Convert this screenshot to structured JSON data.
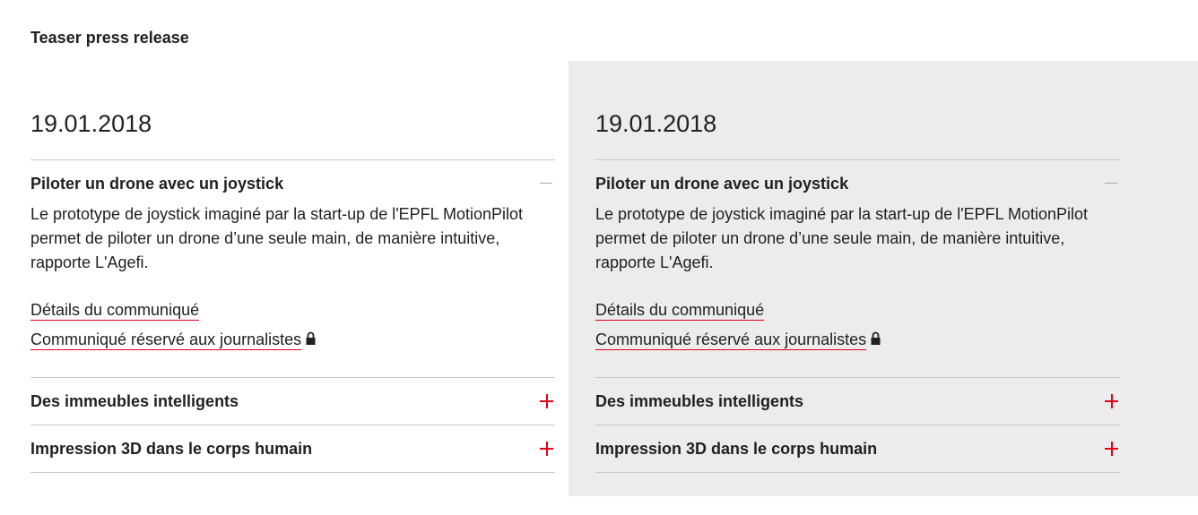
{
  "section": {
    "title": "Teaser press release"
  },
  "columns": [
    {
      "date": "19.01.2018",
      "open_item": {
        "title": "Piloter un drone avec un joystick",
        "description": "Le prototype de joystick imaginé par la start-up de l'EPFL MotionPilot permet de piloter un drone d’une seule main, de manière intuitive, rapporte L'Agefi.",
        "details_link": "Détails du communiqué",
        "journalists_link": "Communiqué réservé aux journalistes"
      },
      "closed_items": [
        {
          "title": "Des immeubles intelligents"
        },
        {
          "title": "Impression 3D dans le corps humain"
        }
      ]
    },
    {
      "date": "19.01.2018",
      "open_item": {
        "title": "Piloter un drone avec un joystick",
        "description": "Le prototype de joystick imaginé par la start-up de l'EPFL MotionPilot permet de piloter un drone d’une seule main, de manière intuitive, rapporte L'Agefi.",
        "details_link": "Détails du communiqué",
        "journalists_link": "Communiqué réservé aux journalistes"
      },
      "closed_items": [
        {
          "title": "Des immeubles intelligents"
        },
        {
          "title": "Impression 3D dans le corps humain"
        }
      ]
    }
  ],
  "icons": {
    "collapse": "minus-icon",
    "expand": "plus-icon",
    "lock": "lock-icon"
  },
  "colors": {
    "accent": "#e2001a",
    "panel_gray": "#ececec",
    "text": "#212121",
    "divider": "#c8c8c8"
  }
}
